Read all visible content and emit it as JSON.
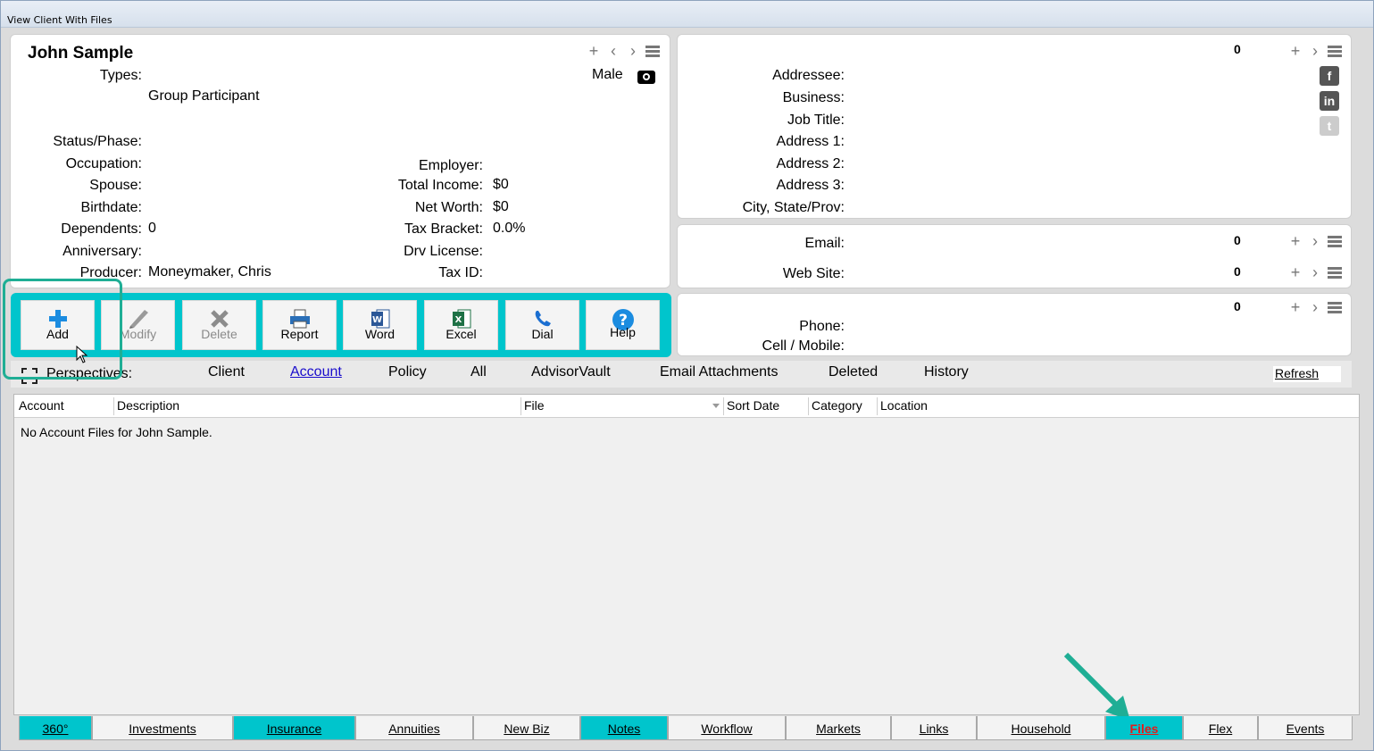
{
  "window": {
    "title": "View Client With Files"
  },
  "client": {
    "name": "John Sample",
    "gender": "Male",
    "types_label": "Types:",
    "types_value": "Group Participant",
    "fields_left": [
      {
        "label": "Status/Phase:",
        "value": ""
      },
      {
        "label": "Occupation:",
        "value": ""
      },
      {
        "label": "Spouse:",
        "value": ""
      },
      {
        "label": "Birthdate:",
        "value": ""
      },
      {
        "label": "Dependents:",
        "value": "0"
      },
      {
        "label": "Anniversary:",
        "value": ""
      },
      {
        "label": "Producer:",
        "value": "Moneymaker, Chris"
      }
    ],
    "fields_right": [
      {
        "label": "Employer:",
        "value": ""
      },
      {
        "label": "Total Income:",
        "value": "$0"
      },
      {
        "label": "Net Worth:",
        "value": "$0"
      },
      {
        "label": "Tax Bracket:",
        "value": "0.0%"
      },
      {
        "label": "Drv License:",
        "value": ""
      },
      {
        "label": "Tax ID:",
        "value": ""
      }
    ]
  },
  "address_panel": {
    "count": "0",
    "fields": [
      {
        "label": "Addressee:"
      },
      {
        "label": "Business:"
      },
      {
        "label": "Job Title:"
      },
      {
        "label": "Address 1:"
      },
      {
        "label": "Address 2:"
      },
      {
        "label": "Address 3:"
      },
      {
        "label": "City, State/Prov:"
      }
    ],
    "social_icons": [
      "facebook-icon",
      "linkedin-icon",
      "twitter-icon"
    ]
  },
  "contact_panel": {
    "email_label": "Email:",
    "email_count": "0",
    "web_label": "Web Site:",
    "web_count": "0"
  },
  "phone_panel": {
    "count": "0",
    "phone_label": "Phone:",
    "cell_label": "Cell / Mobile:"
  },
  "toolbar": {
    "buttons": [
      {
        "label": "Add",
        "icon": "plus-icon",
        "enabled": true
      },
      {
        "label": "Modify",
        "icon": "pencil-icon",
        "enabled": false
      },
      {
        "label": "Delete",
        "icon": "x-icon",
        "enabled": false
      },
      {
        "label": "Report",
        "icon": "printer-icon",
        "enabled": true
      },
      {
        "label": "Word",
        "icon": "word-icon",
        "enabled": true
      },
      {
        "label": "Excel",
        "icon": "excel-icon",
        "enabled": true
      },
      {
        "label": "Dial",
        "icon": "phone-icon",
        "enabled": true
      },
      {
        "label": "Help",
        "icon": "help-icon",
        "enabled": true
      }
    ]
  },
  "perspectives": {
    "label": "Perspectives:",
    "tabs": [
      "Client",
      "Account",
      "Policy",
      "All",
      "AdvisorVault",
      "Email Attachments",
      "Deleted",
      "History"
    ],
    "active": "Account",
    "refresh_label": "Refresh"
  },
  "grid": {
    "columns": [
      "Account",
      "Description",
      "File",
      "Sort Date",
      "Category",
      "Location"
    ],
    "empty_message": "No Account Files for John Sample."
  },
  "bottom_tabs": [
    "360°",
    "Investments",
    "Insurance",
    "Annuities",
    "New Biz",
    "Notes",
    "Workflow",
    "Markets",
    "Links",
    "Household",
    "Files",
    "Flex",
    "Events"
  ],
  "colors": {
    "accent": "#00c5cc",
    "highlight": "#1fae95",
    "files_tab_text": "#e31b1b",
    "link": "#1a0dcc"
  }
}
